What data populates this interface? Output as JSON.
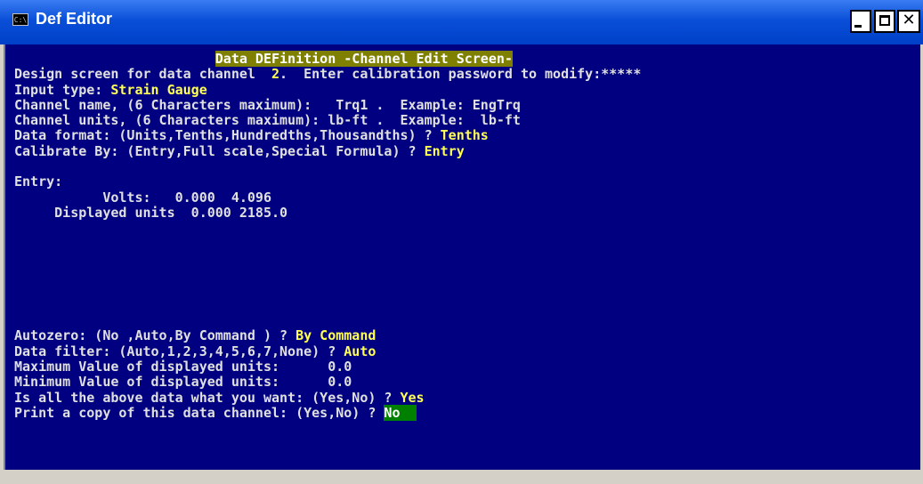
{
  "window": {
    "title": "Def Editor",
    "icon": "console-icon",
    "icon_text": "C:\\"
  },
  "colors": {
    "background": "#000080",
    "text": "#e0e0e0",
    "highlight": "#ffff55",
    "header_bg": "#808000",
    "cursor_bg": "#008000"
  },
  "screen": {
    "header_prefix": "                         ",
    "header": "Data DEFinition -Channel Edit Screen-",
    "design_prefix": "Design screen for data channel  ",
    "channel_number": "2",
    "design_suffix": ".  Enter calibration password to modify:*****",
    "input_type_label": "Input type: ",
    "input_type_value": "Strain Gauge",
    "channel_name_line": "Channel name, (6 Characters maximum):   Trq1 .  Example: EngTrq",
    "channel_units_line": "Channel units, (6 Characters maximum): lb-ft .  Example:  lb-ft",
    "data_format_label": "Data format: (Units,Tenths,Hundredths,Thousandths) ? ",
    "data_format_value": "Tenths",
    "calibrate_label": "Calibrate By: (Entry,Full scale,Special Formula) ? ",
    "calibrate_value": "Entry",
    "entry_label": "Entry:",
    "volts_line": "           Volts:   0.000  4.096",
    "displayed_units_line": "     Displayed units  0.000 2185.0",
    "autozero_label": "Autozero: (No ,Auto,By Command ) ? ",
    "autozero_value": "By Command",
    "data_filter_label": "Data filter: (Auto,1,2,3,4,5,6,7,None) ? ",
    "data_filter_value": "Auto",
    "max_value_line": "Maximum Value of displayed units:      0.0",
    "min_value_line": "Minimum Value of displayed units:      0.0",
    "confirm_label": "Is all the above data what you want: (Yes,No) ? ",
    "confirm_value": "Yes",
    "print_label": "Print a copy of this data channel: (Yes,No) ? ",
    "print_value": "No",
    "print_cursor_pad": "  "
  }
}
